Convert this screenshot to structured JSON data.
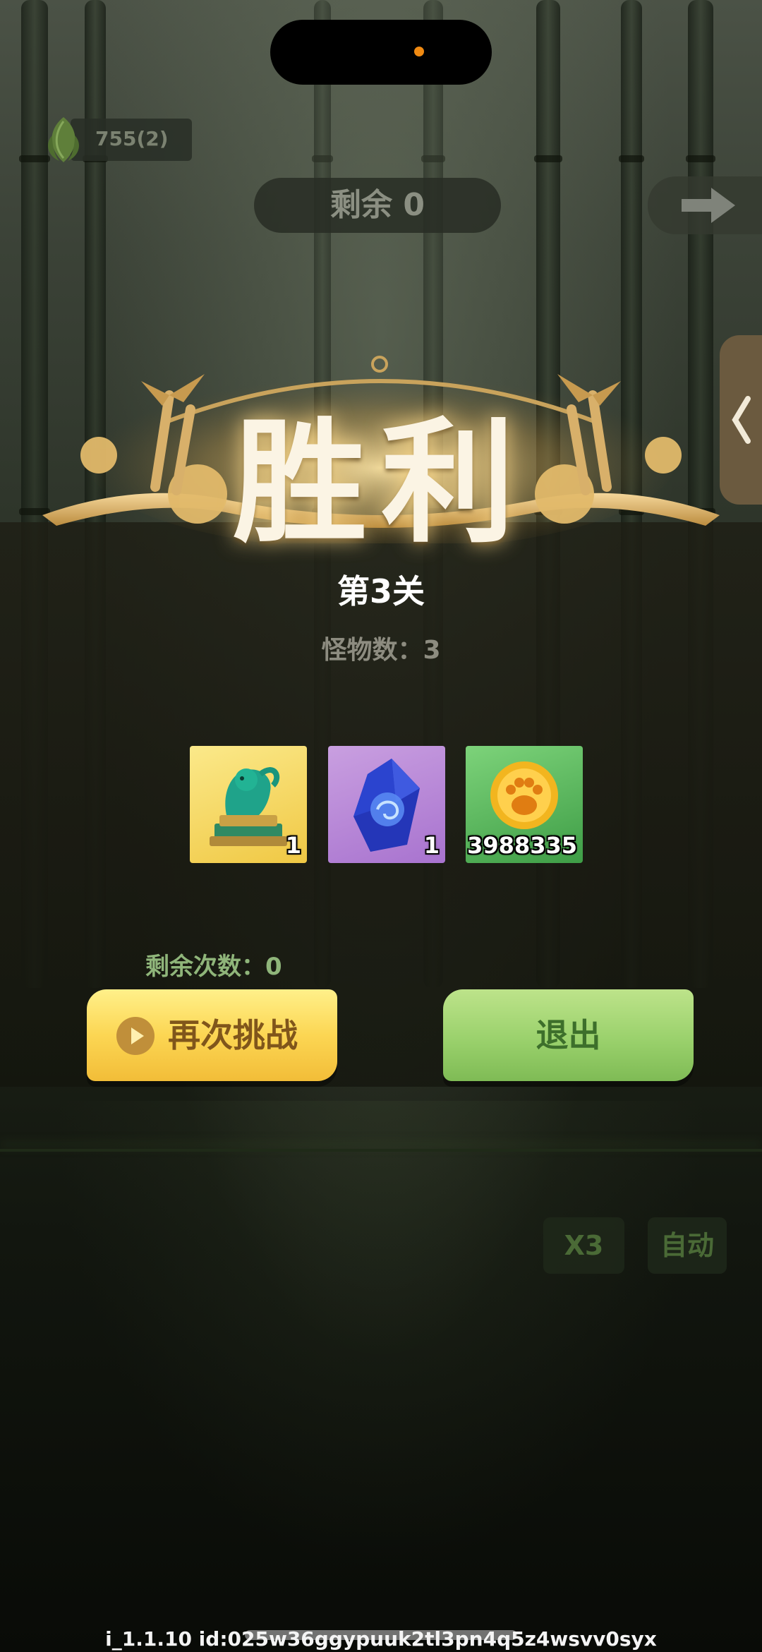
{
  "header": {
    "leaf_count": "755(2)",
    "remaining": "剩余 0"
  },
  "result": {
    "title": "胜利",
    "level": "第3关",
    "monster_count": "怪物数：3"
  },
  "rewards": [
    {
      "name": "jade-qilin-statue",
      "qty": "1"
    },
    {
      "name": "blue-crystal",
      "qty": "1"
    },
    {
      "name": "paw-coin",
      "qty": "3988335"
    }
  ],
  "remaining_attempts": "剩余次数：0",
  "buttons": {
    "retry": "再次挑战",
    "exit": "退出"
  },
  "controls": {
    "speed": "X3",
    "auto": "自动"
  },
  "footer": {
    "version": "i_1.1.10 id:025w36ggypuuk2tl3pn4q5z4wsvv0syx"
  },
  "colors": {
    "retry_button": "#fcd653",
    "exit_button": "#9ad16c",
    "title_glow": "#ffdc8c"
  }
}
